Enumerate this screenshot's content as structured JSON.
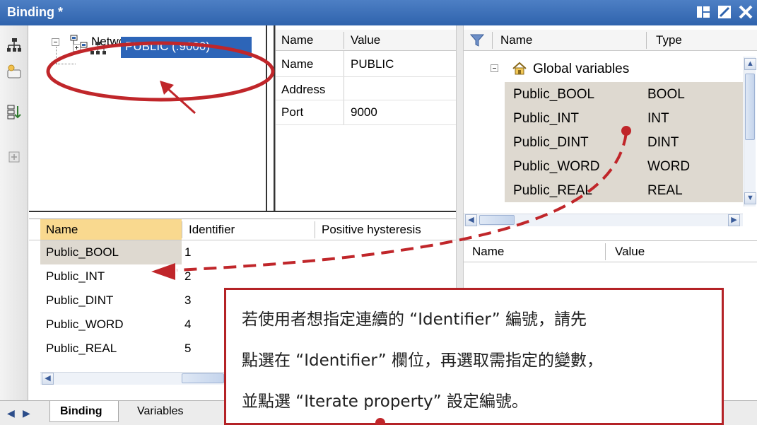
{
  "window": {
    "title": "Binding *"
  },
  "tree": {
    "root_label": "Network",
    "child_label": "PUBLIC (:9000)"
  },
  "props": {
    "headers": [
      "Name",
      "Value"
    ],
    "rows": [
      {
        "name": "Name",
        "value": "PUBLIC"
      },
      {
        "name": "Address",
        "value": ""
      },
      {
        "name": "Port",
        "value": "9000"
      }
    ]
  },
  "globals": {
    "headers": [
      "Name",
      "Type"
    ],
    "group_label": "Global variables",
    "rows": [
      {
        "name": "Public_BOOL",
        "type": "BOOL"
      },
      {
        "name": "Public_INT",
        "type": "INT"
      },
      {
        "name": "Public_DINT",
        "type": "DINT"
      },
      {
        "name": "Public_WORD",
        "type": "WORD"
      },
      {
        "name": "Public_REAL",
        "type": "REAL"
      }
    ]
  },
  "value_panel": {
    "headers": [
      "Name",
      "Value"
    ]
  },
  "bindings": {
    "headers": [
      "Name",
      "Identifier",
      "Positive hysteresis"
    ],
    "rows": [
      {
        "name": "Public_BOOL",
        "id": "1"
      },
      {
        "name": "Public_INT",
        "id": "2"
      },
      {
        "name": "Public_DINT",
        "id": "3"
      },
      {
        "name": "Public_WORD",
        "id": "4"
      },
      {
        "name": "Public_REAL",
        "id": "5"
      }
    ]
  },
  "tabs": [
    "Binding",
    "Variables"
  ],
  "callout": {
    "line1": "若使用者想指定連續的 “Identifier” 編號，請先",
    "line2": "點選在 “Identifier” 欄位，再選取需指定的變數，",
    "line3": "並點選 “Iterate property” 設定編號。"
  },
  "colors": {
    "title_bar": "#2f63ad",
    "selection": "#2d65b8",
    "annotation": "#c0262a"
  }
}
